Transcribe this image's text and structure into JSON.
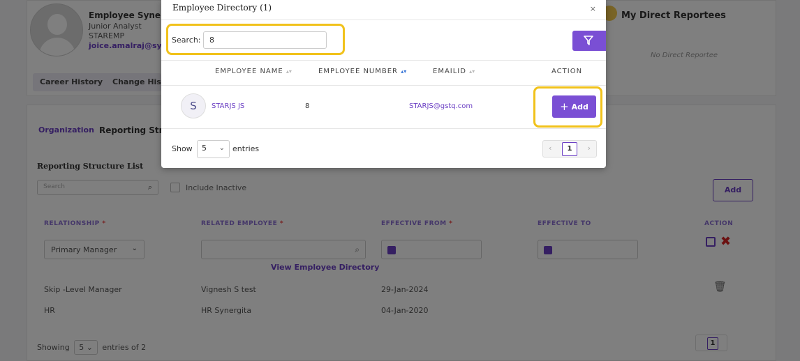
{
  "profile": {
    "name": "Employee Synerg",
    "designation": "Junior Analyst",
    "code": "STAREMP",
    "email": "joice.amalraj@syn",
    "tabs": [
      "Career History",
      "Change Histo"
    ],
    "reportees_title": "My Direct Reportees",
    "no_reportee": "No Direct Reportee"
  },
  "main": {
    "tabs": [
      "Organization",
      "Reporting Stru"
    ],
    "list_title": "Reporting Structure List",
    "search_placeholder": "Search",
    "include_inactive_label": "Include Inactive",
    "add_label": "Add",
    "columns": [
      "RELATIONSHIP",
      "RELATED EMPLOYEE",
      "EFFECTIVE FROM",
      "EFFECTIVE TO",
      "ACTION"
    ],
    "required_mark": "*",
    "relationship_selected": "Primary Manager",
    "view_directory_link": "View Employee Directory",
    "rows": [
      {
        "relationship": "Skip -Level Manager",
        "employee": "Vignesh S test",
        "effective_from": "29-Jan-2024"
      },
      {
        "relationship": "HR",
        "employee": "HR Synergita",
        "effective_from": "04-Jan-2020"
      }
    ],
    "showing_label": "Showing",
    "page_size": "5",
    "entries_of_label": "entries of 2",
    "current_page": "1"
  },
  "modal": {
    "title": "Employee Directory (1)",
    "close_glyph": "×",
    "search_label": "Search:",
    "search_value": "8",
    "headers": [
      "EMPLOYEE NAME",
      "EMPLOYEE NUMBER",
      "EMAILID",
      "ACTION"
    ],
    "rows": [
      {
        "initial": "S",
        "name": "STARJS JS",
        "number": "8",
        "email": "STARJS@gstq.com",
        "action": "Add"
      }
    ],
    "show_label": "Show",
    "page_size": "5",
    "entries_label": "entries",
    "current_page": "1"
  },
  "colors": {
    "accent": "#7a4fd4",
    "highlight": "#f1c21b",
    "delete": "#d62222"
  },
  "icons": [
    "search-icon",
    "filter-icon",
    "plus-icon",
    "close-icon",
    "calendar-icon",
    "save-icon",
    "delete-icon",
    "trash-icon",
    "chevron-down-icon"
  ]
}
